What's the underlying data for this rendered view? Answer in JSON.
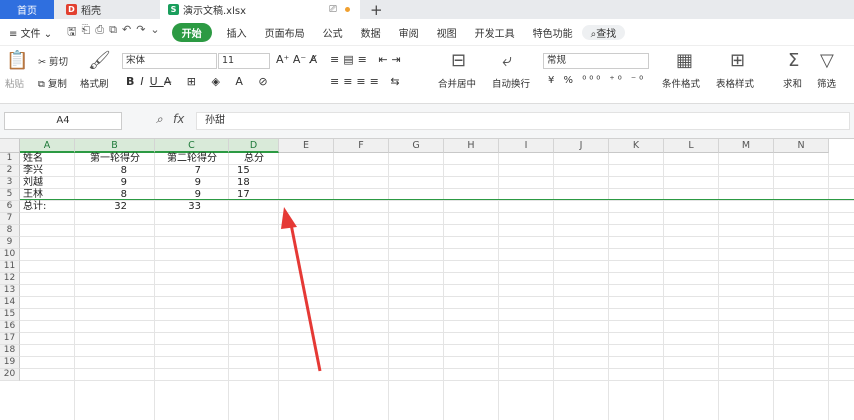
{
  "tabs": {
    "home": "首页",
    "daoke": "稻壳",
    "daoke_logo": "D",
    "file": "演示文稿.xlsx",
    "file_logo": "S"
  },
  "menubar": {
    "file": "文件",
    "items": [
      "开始",
      "插入",
      "页面布局",
      "公式",
      "数据",
      "审阅",
      "视图",
      "开发工具",
      "特色功能"
    ],
    "search": "查找"
  },
  "ribbon": {
    "paste": "粘贴",
    "cut": "剪切",
    "copy": "复制",
    "format_painter": "格式刷",
    "font_name": "宋体",
    "font_size": "11",
    "number_format": "常规",
    "merge_center": "合并居中",
    "auto_wrap": "自动换行",
    "conditional_format": "条件格式",
    "table_style": "表格样式",
    "sum": "求和",
    "filter": "筛选"
  },
  "formula_bar": {
    "cell_ref": "A4",
    "fx": "fx",
    "content": "孙甜"
  },
  "sheet": {
    "columns": [
      "A",
      "B",
      "C",
      "D",
      "E",
      "F",
      "G",
      "H",
      "I",
      "J",
      "K",
      "L",
      "M",
      "N"
    ],
    "rows": [
      "1",
      "2",
      "3",
      "5",
      "6",
      "7",
      "8",
      "9",
      "10",
      "11",
      "12",
      "13",
      "14",
      "15",
      "16",
      "17",
      "18",
      "19",
      "20"
    ],
    "data": [
      [
        "姓名",
        "第一轮得分",
        "第二轮得分",
        "总分"
      ],
      [
        "李兴",
        "8",
        "7",
        "15"
      ],
      [
        "刘越",
        "9",
        "9",
        "18"
      ],
      [
        "王林",
        "8",
        "9",
        "17"
      ],
      [
        "总计:",
        "32",
        "33",
        ""
      ]
    ]
  }
}
